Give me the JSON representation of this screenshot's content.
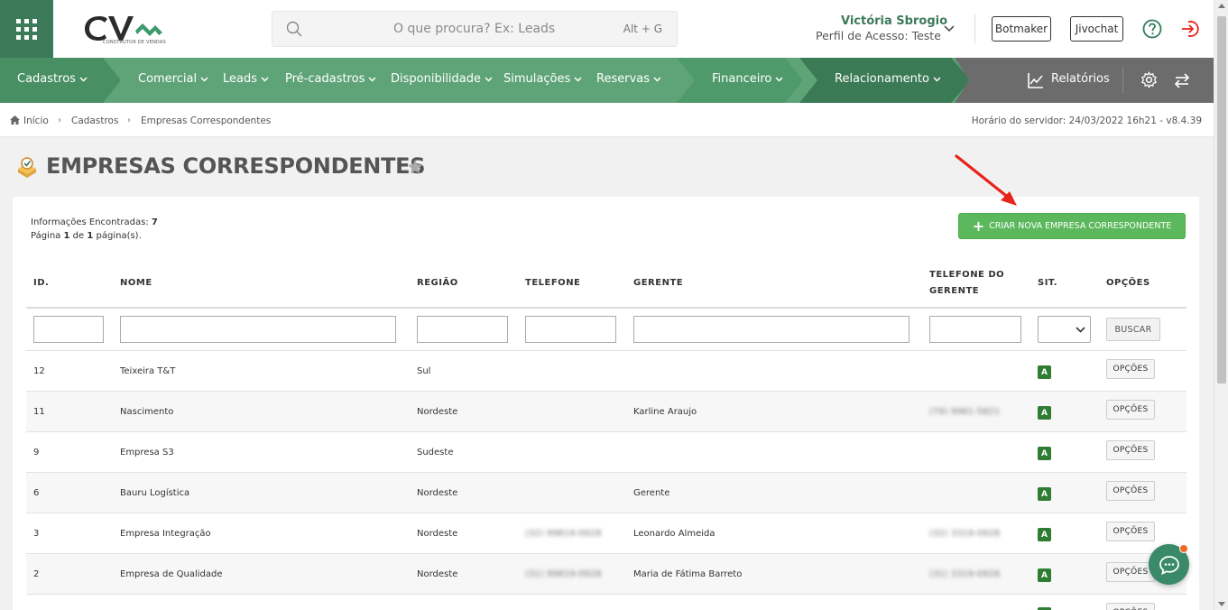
{
  "header": {
    "logo_text": "CONSTRUTOR DE VENDAS",
    "search_placeholder": "O que procura? Ex: Leads",
    "search_shortcut": "Alt + G",
    "user_name": "Victória Sbrogio",
    "user_profile": "Perfil de Acesso: Teste",
    "botmaker_label": "Botmaker",
    "jivochat_label": "Jivochat"
  },
  "nav": {
    "items": [
      "Cadastros",
      "Comercial",
      "Leads",
      "Pré-cadastros",
      "Disponibilidade",
      "Simulações",
      "Reservas",
      "Financeiro",
      "Relacionamento"
    ],
    "relatorios": "Relatórios"
  },
  "breadcrumb": {
    "items": [
      "Início",
      "Cadastros",
      "Empresas Correspondentes"
    ],
    "server_time": "Horário do servidor: 24/03/2022 16h21 - v8.4.39"
  },
  "page": {
    "title": "EMPRESAS CORRESPONDENTES",
    "info_found_label": "Informações Encontradas:",
    "info_found_count": "7",
    "page_label_prefix": "Página",
    "page_current": "1",
    "page_of": "de",
    "page_total": "1",
    "page_suffix": "página(s).",
    "create_button": "CRIAR NOVA EMPRESA CORRESPONDENTE"
  },
  "table": {
    "columns": {
      "id": "ID.",
      "nome": "NOME",
      "regiao": "REGIÃO",
      "telefone": "TELEFONE",
      "gerente": "GERENTE",
      "telefone_gerente": "TELEFONE DO GERENTE",
      "sit": "SIT.",
      "opcoes": "OPÇÕES"
    },
    "buscar_label": "BUSCAR",
    "options_label": "OPÇÕES",
    "rows": [
      {
        "id": "12",
        "nome": "Teixeira T&T",
        "regiao": "Sul",
        "telefone": "",
        "gerente": "",
        "telefone_gerente": "",
        "sit": "A"
      },
      {
        "id": "11",
        "nome": "Nascimento",
        "regiao": "Nordeste",
        "telefone": "",
        "gerente": "Karline Araujo",
        "telefone_gerente": "(79) 9961-5821",
        "sit": "A"
      },
      {
        "id": "9",
        "nome": "Empresa S3",
        "regiao": "Sudeste",
        "telefone": "",
        "gerente": "",
        "telefone_gerente": "",
        "sit": "A"
      },
      {
        "id": "6",
        "nome": "Bauru Logística",
        "regiao": "Nordeste",
        "telefone": "",
        "gerente": "Gerente",
        "telefone_gerente": "",
        "sit": "A"
      },
      {
        "id": "3",
        "nome": "Empresa Integração",
        "regiao": "Nordeste",
        "telefone": "(32) 99819-0928",
        "gerente": "Leonardo Almeida",
        "telefone_gerente": "(32) 3319-0928",
        "sit": "A"
      },
      {
        "id": "2",
        "nome": "Empresa de Qualidade",
        "regiao": "Nordeste",
        "telefone": "(31) 99819-0928",
        "gerente": "Maria de Fátima Barreto",
        "telefone_gerente": "(31) 3319-0928",
        "sit": "A"
      },
      {
        "id": "",
        "nome": "",
        "regiao": "",
        "telefone": "",
        "gerente": "",
        "telefone_gerente": "",
        "sit": "A"
      }
    ]
  },
  "colors": {
    "brand_green": "#3d7a5a",
    "nav_green": "#5fa478",
    "create_green": "#5cb85c",
    "status_green": "#2e7d32",
    "arrow_red": "#e8231b",
    "chat_dot": "#f26b22"
  },
  "icons": [
    "apps-grid-icon",
    "search-icon",
    "chevron-down-icon",
    "help-icon",
    "logout-icon",
    "chart-line-icon",
    "gear-icon",
    "swap-icon",
    "home-icon",
    "building-icon",
    "star-icon",
    "plus-icon",
    "chat-icon"
  ]
}
